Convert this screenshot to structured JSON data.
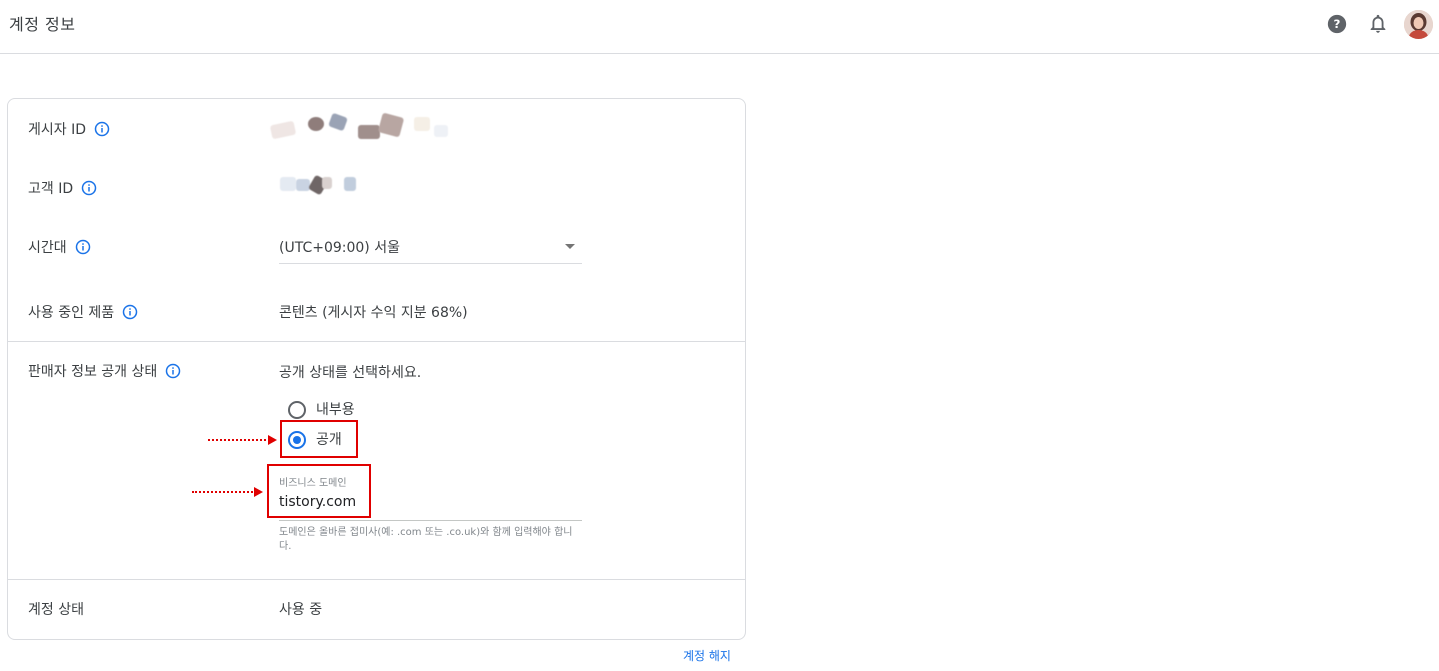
{
  "header": {
    "title": "계정 정보",
    "icons": [
      "help-icon",
      "notifications-icon",
      "avatar"
    ]
  },
  "rows": {
    "publisher_id": {
      "label": "게시자 ID"
    },
    "customer_id": {
      "label": "고객 ID"
    },
    "timezone": {
      "label": "시간대",
      "value": "(UTC+09:00) 서울"
    },
    "products": {
      "label": "사용 중인 제품",
      "value": "콘텐츠 (게시자 수익 지분 68%)"
    },
    "seller_info": {
      "label": "판매자 정보 공개 상태",
      "prompt": "공개 상태를 선택하세요.",
      "options": [
        "내부용",
        "공개"
      ],
      "selected": "공개",
      "domain_field_label": "비즈니스 도메인",
      "domain_value": "tistory.com",
      "domain_hint": "도메인은 올바른 접미사(예: .com 또는 .co.uk)와 함께 입력해야 합니다."
    },
    "account_status": {
      "label": "계정 상태",
      "value": "사용 중"
    }
  },
  "footer": {
    "close_account_link": "계정 해지"
  },
  "colors": {
    "accent": "#1a73e8",
    "annotation_red": "#e00000",
    "border": "#dadce0"
  }
}
